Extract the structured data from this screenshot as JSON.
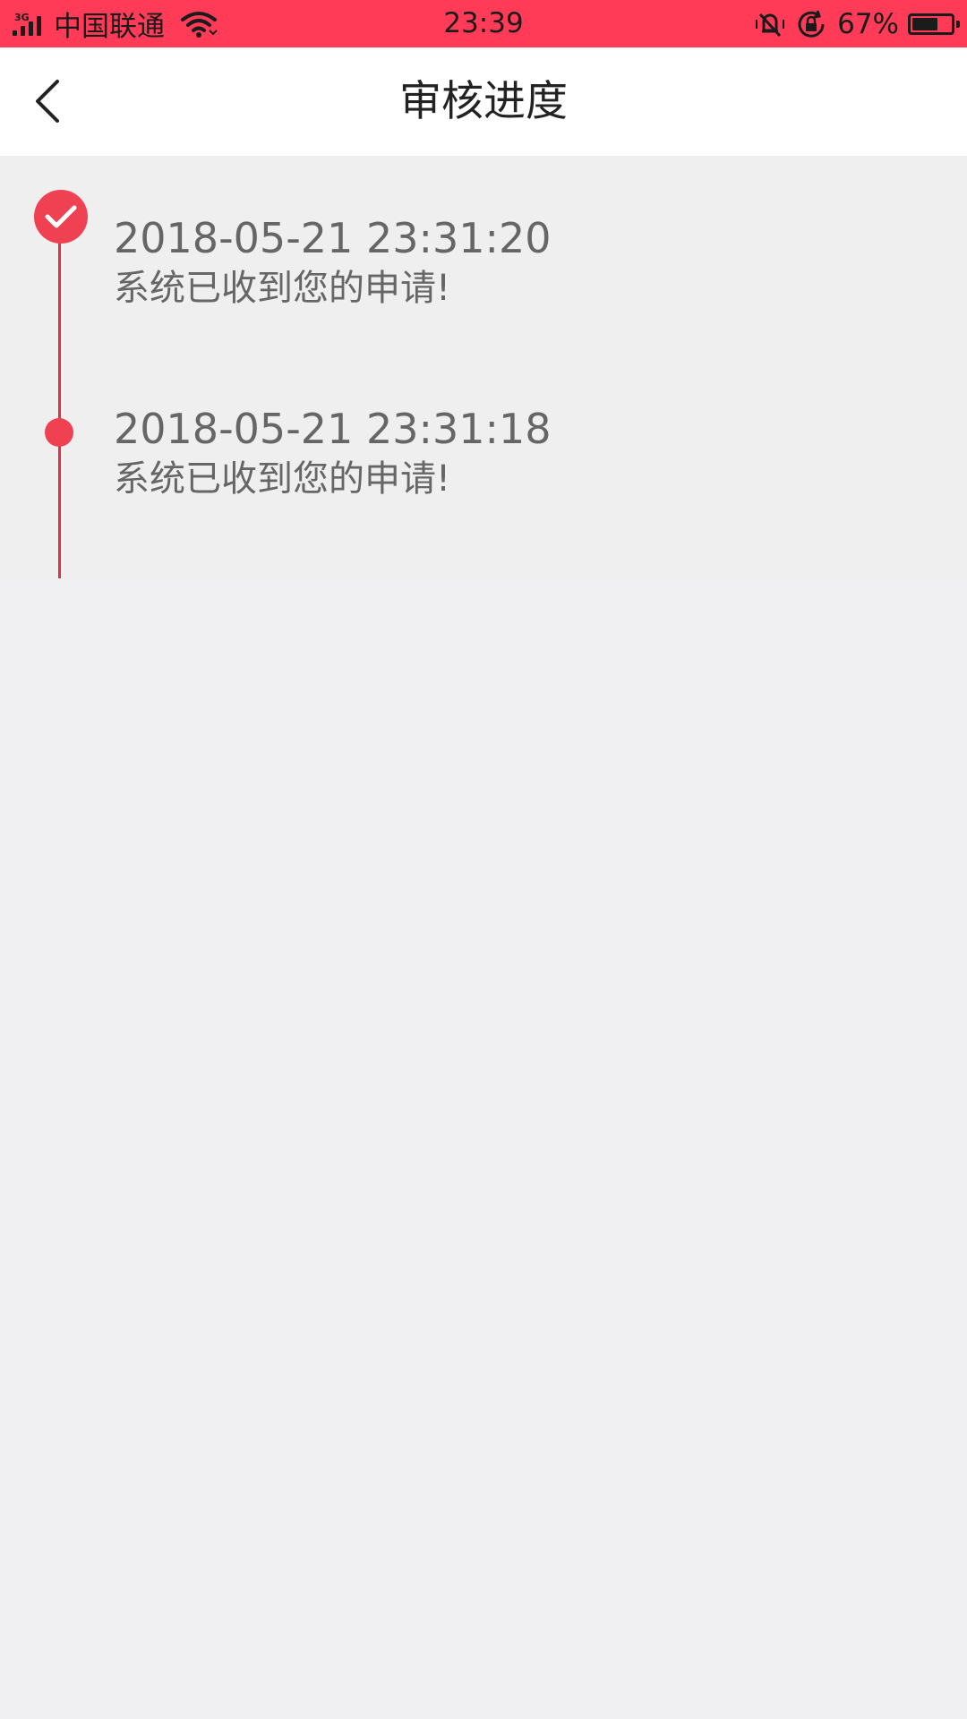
{
  "status_bar": {
    "network": "3G",
    "carrier": "中国联通",
    "time": "23:39",
    "battery": "67%",
    "battery_level": 0.67,
    "icons": [
      "signal-icon",
      "wifi-icon",
      "vibrate-icon",
      "rotation-lock-icon",
      "battery-icon"
    ]
  },
  "header": {
    "title": "审核进度",
    "back_icon": "chevron-left-icon"
  },
  "timeline": {
    "accent_color": "#f04152",
    "entries": [
      {
        "time": "2018-05-21 23:31:20",
        "message": "系统已收到您的申请!",
        "status": "completed"
      },
      {
        "time": "2018-05-21 23:31:18",
        "message": "系统已收到您的申请!",
        "status": "point"
      }
    ]
  },
  "colors": {
    "status_bar": "#ff3b57",
    "background": "#f0f0f2",
    "text": "#666666"
  }
}
